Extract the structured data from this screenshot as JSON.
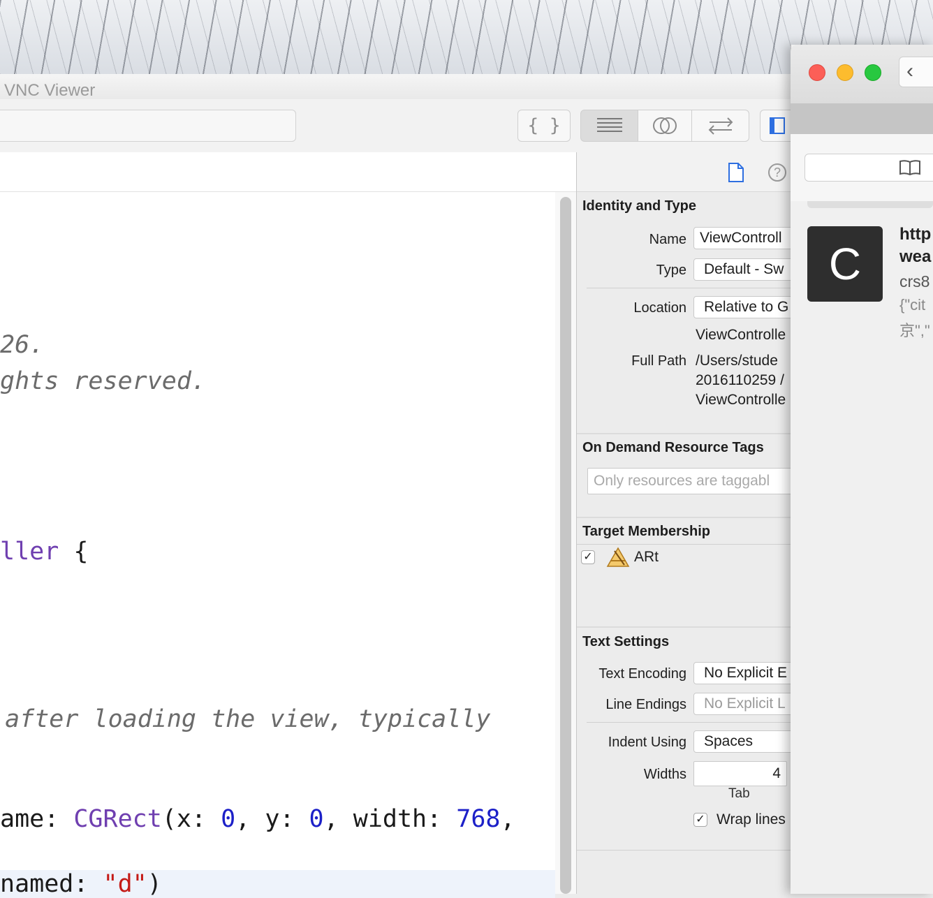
{
  "vnc": {
    "title": "VNC Viewer"
  },
  "toolbar": {
    "braces_label": "{ }"
  },
  "editor": {
    "lines": {
      "l1": "26.",
      "l2": "ghts reserved.",
      "l3_name": "ller",
      "l3_brace": " {",
      "l4": " after loading the view, typically",
      "l5_a": "ame: ",
      "l5_type": "CGRect",
      "l5_b": "(x: ",
      "l5_n1": "0",
      "l5_c": ", y: ",
      "l5_n2": "0",
      "l5_d": ", width: ",
      "l5_n3": "768",
      "l5_e": ",",
      "l6_a": "named: ",
      "l6_str": "\"d\"",
      "l6_b": ")"
    }
  },
  "inspector": {
    "identity": {
      "title": "Identity and Type",
      "name_label": "Name",
      "name_value": "ViewControll",
      "type_label": "Type",
      "type_value": "Default - Sw",
      "location_label": "Location",
      "location_value": "Relative to G",
      "location_file": "ViewControlle",
      "fullpath_label": "Full Path",
      "fullpath_line1": "/Users/stude",
      "fullpath_line2": "2016110259 /",
      "fullpath_line3": "ViewControlle"
    },
    "odr": {
      "title": "On Demand Resource Tags",
      "placeholder": "Only resources are taggabl"
    },
    "target": {
      "title": "Target Membership",
      "item": "ARt",
      "checked": "✓"
    },
    "text_settings": {
      "title": "Text Settings",
      "encoding_label": "Text Encoding",
      "encoding_value": "No Explicit E",
      "endings_label": "Line Endings",
      "endings_value": "No Explicit L",
      "indent_label": "Indent Using",
      "indent_value": "Spaces",
      "widths_label": "Widths",
      "tab_value": "4",
      "tab_label": "Tab",
      "wrap_label": "Wrap lines",
      "wrap_checked": "✓"
    }
  },
  "browser": {
    "back_glyph": "‹",
    "avatar_letter": "C",
    "line1": "http",
    "line2": "wea",
    "line3": "crs8",
    "line4": "{\"cit",
    "line5": "京\",\""
  }
}
